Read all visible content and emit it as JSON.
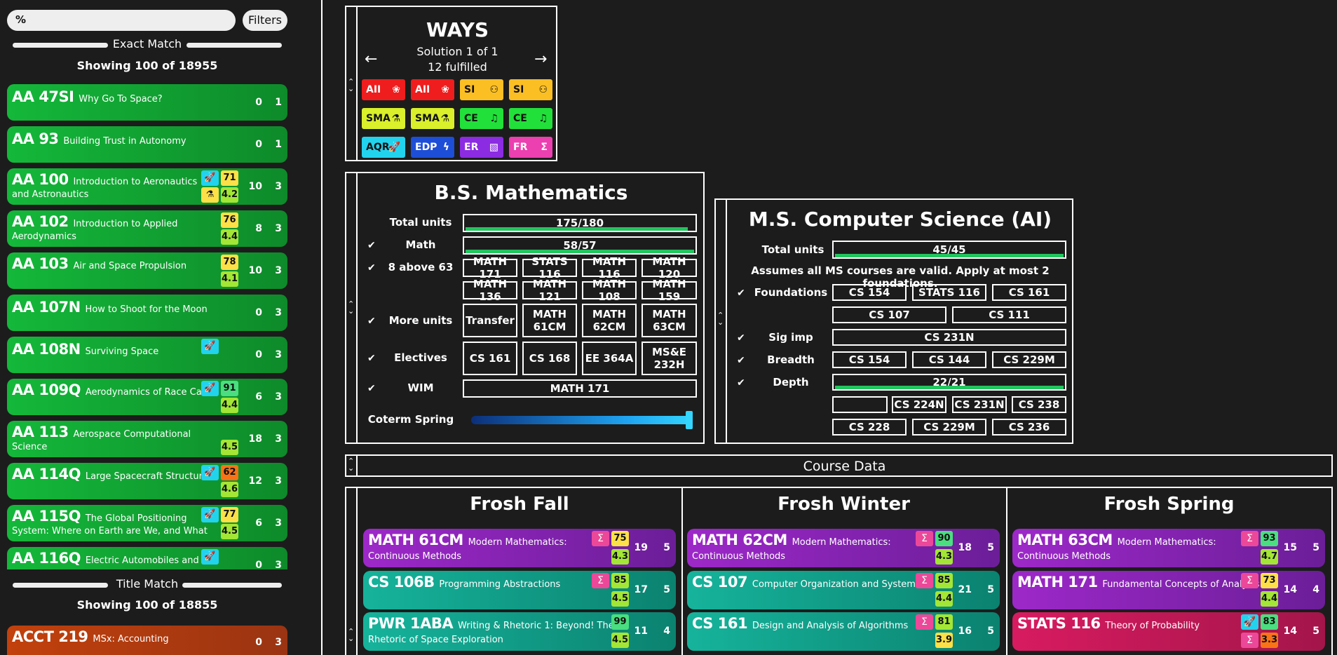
{
  "sidebar": {
    "search_value": "%",
    "filters_label": "Filters",
    "exact_match_label": "Exact Match",
    "exact_showing": "Showing 100 of 18955",
    "title_match_label": "Title Match",
    "title_showing": "Showing 100 of 18855",
    "courses": [
      {
        "code": "AA 47SI",
        "title": "Why Go To Space?",
        "n1": "0",
        "n2": "1"
      },
      {
        "code": "AA 93",
        "title": "Building Trust in Autonomy",
        "n1": "0",
        "n2": "1"
      },
      {
        "code": "AA 100",
        "title": "Introduction to Aeronautics",
        "title2": "and Astronautics",
        "n1": "10",
        "n2": "3",
        "score": "71",
        "rating": "4.2"
      },
      {
        "code": "AA 102",
        "title": "Introduction to Applied",
        "title2": "Aerodynamics",
        "n1": "8",
        "n2": "3",
        "score": "76",
        "rating": "4.4"
      },
      {
        "code": "AA 103",
        "title": "Air and Space Propulsion",
        "n1": "10",
        "n2": "3",
        "score": "78",
        "rating": "4.1"
      },
      {
        "code": "AA 107N",
        "title": "How to Shoot for the Moon",
        "n1": "0",
        "n2": "3"
      },
      {
        "code": "AA 108N",
        "title": "Surviving Space",
        "n1": "0",
        "n2": "3"
      },
      {
        "code": "AA 109Q",
        "title": "Aerodynamics of Race Cars",
        "n1": "6",
        "n2": "3",
        "score": "91",
        "rating": "4.4"
      },
      {
        "code": "AA 113",
        "title": "Aerospace Computational",
        "title2": "Science",
        "n1": "18",
        "n2": "3",
        "rating": "4.5"
      },
      {
        "code": "AA 114Q",
        "title": "Large Spacecraft Structures",
        "n1": "12",
        "n2": "3",
        "score": "62",
        "rating": "4.6"
      },
      {
        "code": "AA 115Q",
        "title": "The Global Positioning",
        "title2": "System: Where on Earth are We, and What",
        "n1": "6",
        "n2": "3",
        "score": "77",
        "rating": "4.5"
      },
      {
        "code": "AA 116Q",
        "title": "Electric Automobiles and",
        "n1": "0",
        "n2": "3"
      }
    ],
    "title_course": {
      "code": "ACCT 219",
      "title": "MSx: Accounting",
      "n1": "0",
      "n2": "3"
    }
  },
  "ways": {
    "title": "WAYS",
    "solution": "Solution 1 of 1",
    "fulfilled": "12 fulfilled",
    "badges": [
      {
        "label": "AII",
        "icon": "flower-icon",
        "color": "#ef1d1d"
      },
      {
        "label": "AII",
        "icon": "flower-icon",
        "color": "#ef1d1d"
      },
      {
        "label": "SI",
        "icon": "person-icon",
        "color": "#fbbf24"
      },
      {
        "label": "SI",
        "icon": "person-icon",
        "color": "#fbbf24"
      },
      {
        "label": "SMA",
        "icon": "flask-icon",
        "color": "#d9f02a"
      },
      {
        "label": "SMA",
        "icon": "flask-icon",
        "color": "#d9f02a"
      },
      {
        "label": "CE",
        "icon": "music-icon",
        "color": "#22e03a"
      },
      {
        "label": "CE",
        "icon": "music-icon",
        "color": "#22e03a"
      },
      {
        "label": "AQR",
        "icon": "rocket-icon",
        "color": "#22d3ee"
      },
      {
        "label": "EDP",
        "icon": "bolt-icon",
        "color": "#1d4ed8"
      },
      {
        "label": "ER",
        "icon": "ruler-icon",
        "color": "#8b2be2"
      },
      {
        "label": "FR",
        "icon": "sigma-icon",
        "color": "#ec3fb0"
      }
    ]
  },
  "bs": {
    "title": "B.S. Mathematics",
    "total_label": "Total units",
    "total_value": "175/180",
    "total_progress": 0.972,
    "math_label": "Math",
    "math_value": "58/57",
    "math_progress": 1.0,
    "above_label": "8 above 63",
    "above_courses": [
      "MATH 171",
      "STATS 116",
      "MATH 116",
      "MATH 120",
      "MATH 136",
      "MATH 121",
      "MATH 108",
      "MATH 159"
    ],
    "more_label": "More units",
    "more_courses": [
      "Transfer",
      "MATH 61CM",
      "MATH 62CM",
      "MATH 63CM"
    ],
    "electives_label": "Electives",
    "electives": [
      "CS 161",
      "CS 168",
      "EE 364A",
      "MS&E 232H"
    ],
    "wim_label": "WIM",
    "wim_course": "MATH 171",
    "coterm_label": "Coterm Spring",
    "check": "✔"
  },
  "ms": {
    "title": "M.S. Computer Science (AI)",
    "total_label": "Total units",
    "total_value": "45/45",
    "total_progress": 1.0,
    "note": "Assumes all MS courses are valid. Apply at most 2 foundations.",
    "foundations_label": "Foundations",
    "foundations": [
      "CS 154",
      "STATS 116",
      "CS 161",
      "CS 107",
      "CS 111"
    ],
    "sigimp_label": "Sig imp",
    "sigimp": "CS 231N",
    "breadth_label": "Breadth",
    "breadth": [
      "CS 154",
      "CS 144",
      "CS 229M"
    ],
    "depth_label": "Depth",
    "depth_value": "22/21",
    "depth_progress": 1.0,
    "depth_courses": [
      "",
      "CS 224N",
      "CS 231N",
      "CS 238",
      "CS 228",
      "CS 229M",
      "CS 236"
    ]
  },
  "course_data_label": "Course Data",
  "plan": {
    "columns": [
      {
        "title": "Frosh Fall",
        "courses": [
          {
            "code": "MATH 61CM",
            "title": "Modern Mathematics:",
            "title2": "Continuous Methods",
            "score": "75",
            "rating": "4.3",
            "n1": "19",
            "n2": "5",
            "color": "purple"
          },
          {
            "code": "CS 106B",
            "title": "Programming Abstractions",
            "score": "85",
            "rating": "4.5",
            "n1": "17",
            "n2": "5",
            "color": "teal"
          },
          {
            "code": "PWR 1ABA",
            "title": "Writing & Rhetoric 1: Beyond! The",
            "title2": "Rhetoric of Space Exploration",
            "score": "99",
            "rating": "4.5",
            "n1": "11",
            "n2": "4",
            "color": "teal"
          }
        ]
      },
      {
        "title": "Frosh Winter",
        "courses": [
          {
            "code": "MATH 62CM",
            "title": "Modern Mathematics:",
            "title2": "Continuous Methods",
            "score": "90",
            "rating": "4.3",
            "n1": "18",
            "n2": "5",
            "color": "purple"
          },
          {
            "code": "CS 107",
            "title": "Computer Organization and Systems",
            "score": "85",
            "rating": "4.4",
            "n1": "21",
            "n2": "5",
            "color": "teal"
          },
          {
            "code": "CS 161",
            "title": "Design and Analysis of Algorithms",
            "score": "81",
            "rating": "3.9",
            "n1": "16",
            "n2": "5",
            "color": "teal"
          }
        ]
      },
      {
        "title": "Frosh Spring",
        "courses": [
          {
            "code": "MATH 63CM",
            "title": "Modern Mathematics:",
            "title2": "Continuous Methods",
            "score": "93",
            "rating": "4.7",
            "n1": "15",
            "n2": "5",
            "color": "purple"
          },
          {
            "code": "MATH 171",
            "title": "Fundamental Concepts of Analysis",
            "score": "73",
            "rating": "4.4",
            "n1": "14",
            "n2": "4",
            "color": "purple"
          },
          {
            "code": "STATS 116",
            "title": "Theory of Probability",
            "score": "83",
            "rating": "3.3",
            "n1": "14",
            "n2": "5",
            "color": "pink"
          }
        ]
      }
    ]
  },
  "icons": {
    "sigma": "Σ",
    "rocket": "🚀",
    "flask": "⚗"
  }
}
